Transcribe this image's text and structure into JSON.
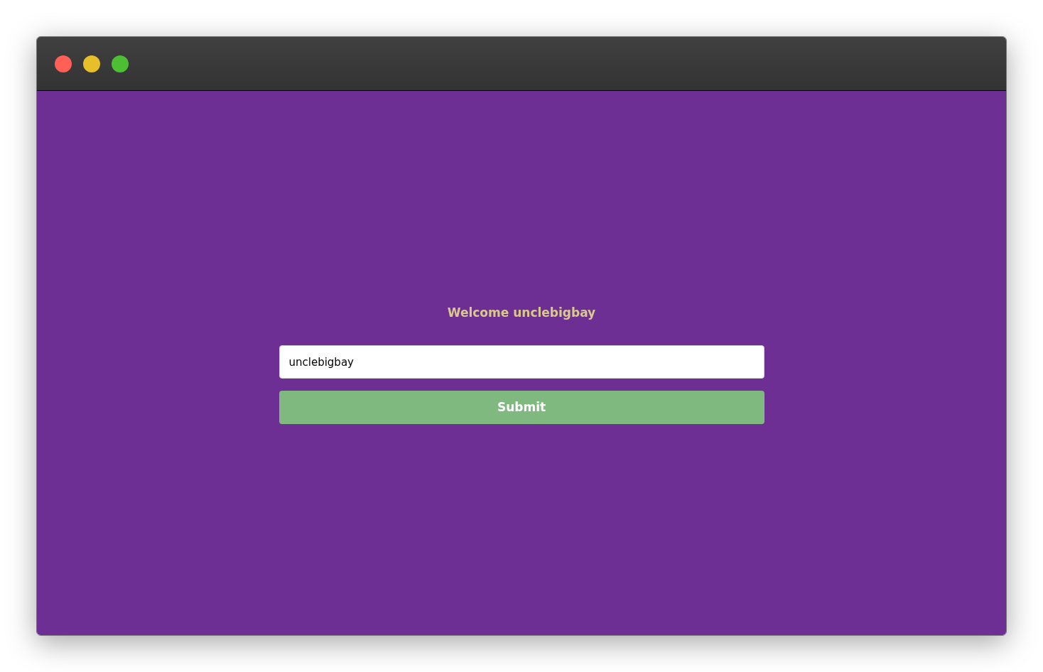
{
  "window": {
    "controls": [
      {
        "color": "#ff5f57"
      },
      {
        "color": "#e6bf2a"
      },
      {
        "color": "#4cc032"
      }
    ]
  },
  "greeting": "Welcome unclebigbay",
  "name_field": {
    "value": "unclebigbay"
  },
  "submit_button": "Submit"
}
